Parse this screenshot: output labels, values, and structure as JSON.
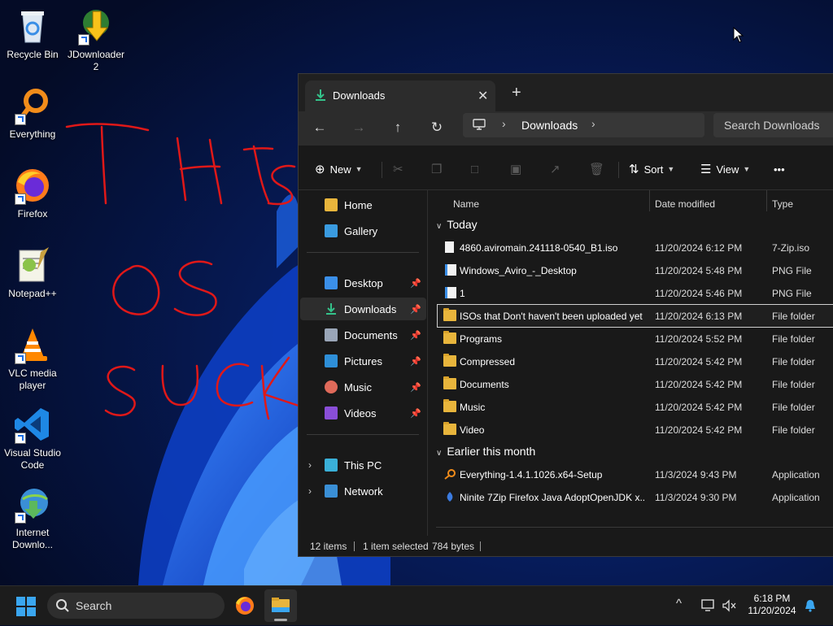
{
  "desktop": {
    "icons": [
      {
        "label": "Recycle Bin",
        "icon": "recycle-bin-icon"
      },
      {
        "label": "JDownloader 2",
        "icon": "jdownloader-icon"
      },
      {
        "label": "Everything",
        "icon": "everything-search-icon"
      },
      {
        "label": "Firefox",
        "icon": "firefox-icon"
      },
      {
        "label": "Notepad++",
        "icon": "notepad-plus-plus-icon"
      },
      {
        "label": "VLC media player",
        "icon": "vlc-icon"
      },
      {
        "label": "Visual Studio Code",
        "icon": "vscode-icon"
      },
      {
        "label": "Internet Downlo...",
        "icon": "internet-download-manager-icon"
      }
    ],
    "scribble_text": "THIS OS SUCK",
    "scribble_color": "#e01818"
  },
  "explorer": {
    "tab_title": "Downloads",
    "new_tab": "+",
    "close": "✕",
    "breadcrumb": "Downloads",
    "search_placeholder": "Search Downloads",
    "commands": {
      "new_label": "New",
      "sort_label": "Sort",
      "view_label": "View",
      "more": "•••"
    },
    "nav": {
      "home": "Home",
      "gallery": "Gallery",
      "desktop": "Desktop",
      "downloads": "Downloads",
      "documents": "Documents",
      "pictures": "Pictures",
      "music": "Music",
      "videos": "Videos",
      "this_pc": "This PC",
      "network": "Network"
    },
    "columns": {
      "name": "Name",
      "date": "Date modified",
      "type": "Type"
    },
    "groups": {
      "today": "Today",
      "earlier": "Earlier this month"
    },
    "rows": [
      {
        "name": "4860.aviromain.241118-0540_B1.iso",
        "date": "11/20/2024 6:12 PM",
        "type": "7-Zip.iso"
      },
      {
        "name": "Windows_Aviro_-_Desktop",
        "date": "11/20/2024 5:48 PM",
        "type": "PNG File"
      },
      {
        "name": "1",
        "date": "11/20/2024 5:46 PM",
        "type": "PNG File"
      },
      {
        "name": "ISOs that Don't haven't been uploaded yet",
        "date": "11/20/2024 6:13 PM",
        "type": "File folder"
      },
      {
        "name": "Programs",
        "date": "11/20/2024 5:52 PM",
        "type": "File folder"
      },
      {
        "name": "Compressed",
        "date": "11/20/2024 5:42 PM",
        "type": "File folder"
      },
      {
        "name": "Documents",
        "date": "11/20/2024 5:42 PM",
        "type": "File folder"
      },
      {
        "name": "Music",
        "date": "11/20/2024 5:42 PM",
        "type": "File folder"
      },
      {
        "name": "Video",
        "date": "11/20/2024 5:42 PM",
        "type": "File folder"
      },
      {
        "name": "Everything-1.4.1.1026.x64-Setup",
        "date": "11/3/2024 9:43 PM",
        "type": "Application"
      },
      {
        "name": "Ninite 7Zip Firefox Java AdoptOpenJDK x...",
        "date": "11/3/2024 9:30 PM",
        "type": "Application"
      }
    ],
    "status": {
      "items": "12 items",
      "selected": "1 item selected",
      "size": "784 bytes"
    }
  },
  "taskbar": {
    "search_label": "Search",
    "time": "6:18 PM",
    "date": "11/20/2024",
    "tray_chevron": "^"
  },
  "colors": {
    "accent": "#4cc2ff",
    "folder": "#e8b53c",
    "explorer_bg": "#191919"
  }
}
